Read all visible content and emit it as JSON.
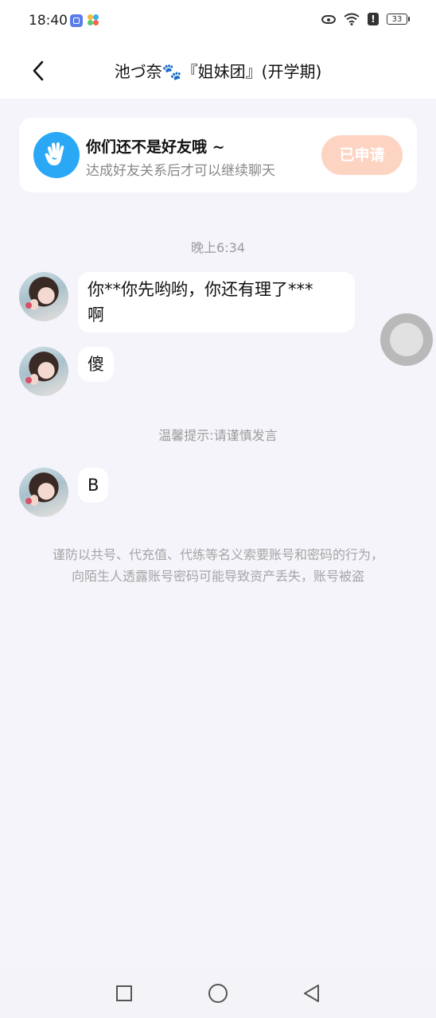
{
  "status_bar": {
    "time": "18:40",
    "battery": "33"
  },
  "header": {
    "title": "池づ奈🐾『姐妹团』(开学期)"
  },
  "friend_notice": {
    "title": "你们还不是好友哦 ~",
    "subtitle": "达成好友关系后才可以继续聊天",
    "button_label": "已申请"
  },
  "chat": {
    "timestamp": "晚上6:34",
    "messages": [
      {
        "text": "你**你先哟哟，你还有理了***\n啊"
      },
      {
        "text": "傻"
      },
      {
        "text": "B"
      }
    ],
    "hint": "温馨提示:请谨慎发言",
    "warning_line1": "谨防以共号、代充值、代练等名义索要账号和密码的行为，",
    "warning_line2": "向陌生人透露账号密码可能导致资产丢失，账号被盗"
  },
  "colors": {
    "accent_blue": "#2aa8f5",
    "applied_button": "#fdd4c2",
    "background": "#f4f4fa"
  }
}
